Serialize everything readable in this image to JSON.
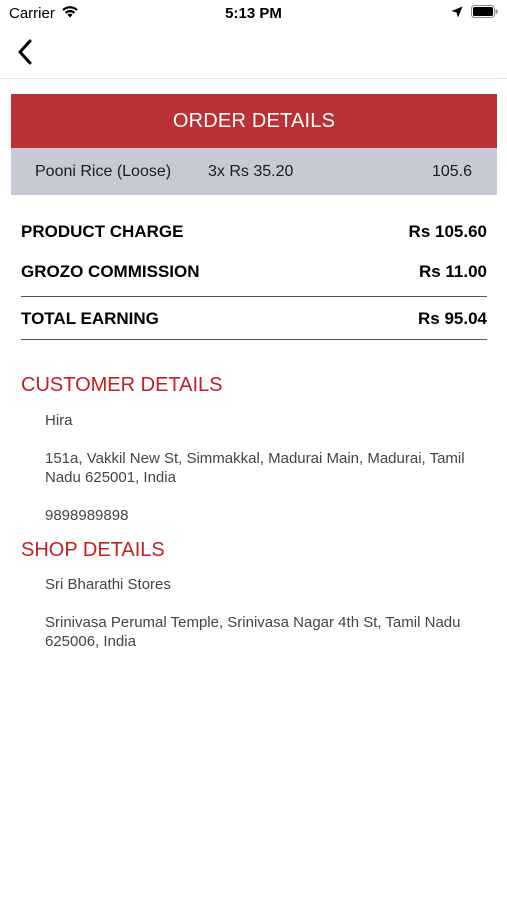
{
  "status_bar": {
    "carrier": "Carrier",
    "time": "5:13 PM"
  },
  "order": {
    "header": "ORDER DETAILS",
    "items": [
      {
        "name": "Pooni Rice (Loose)",
        "qty_price": "3x Rs 35.20",
        "total": "105.6"
      }
    ]
  },
  "summary": {
    "product_charge_label": "PRODUCT CHARGE",
    "product_charge_value": "Rs 105.60",
    "commission_label": "GROZO COMMISSION",
    "commission_value": "Rs 11.00",
    "total_label": "TOTAL EARNING",
    "total_value": "Rs 95.04"
  },
  "customer": {
    "title": "CUSTOMER DETAILS",
    "name": "Hira",
    "address": "151a, Vakkil New St, Simmakkal, Madurai Main, Madurai, Tamil Nadu 625001, India",
    "phone": "9898989898"
  },
  "shop": {
    "title": "SHOP DETAILS",
    "name": "Sri Bharathi Stores",
    "address": "Srinivasa Perumal Temple, Srinivasa Nagar 4th St, Tamil Nadu 625006, India"
  },
  "colors": {
    "accent": "#b83236",
    "section_title": "#c41e23",
    "item_row_bg": "#c7c9d4"
  }
}
